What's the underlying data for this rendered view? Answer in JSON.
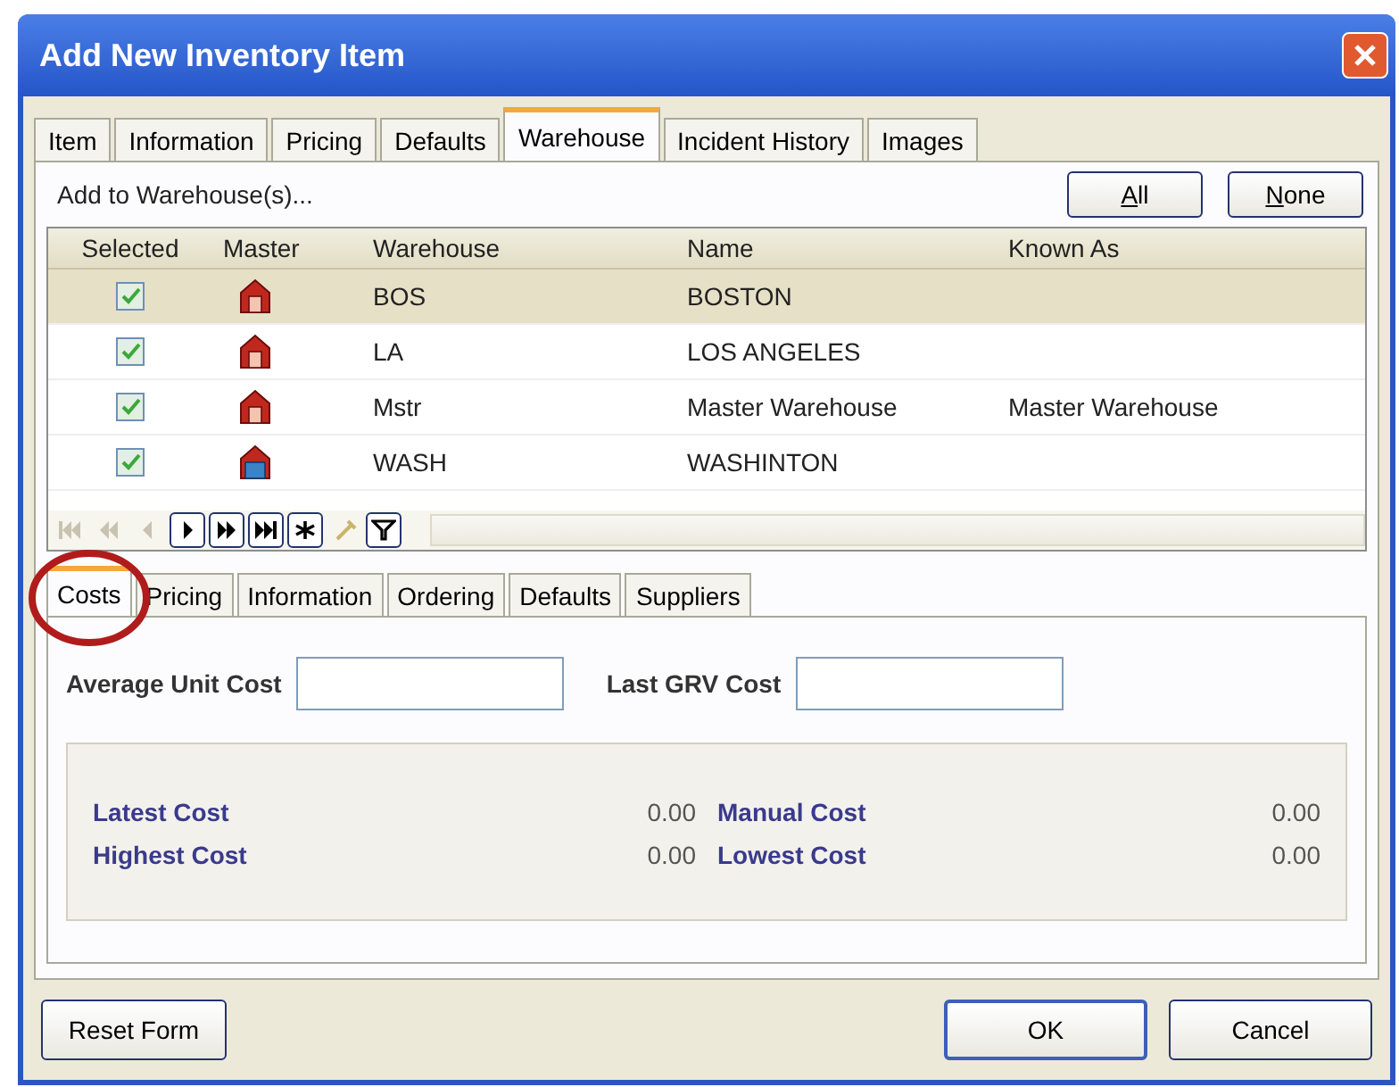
{
  "window": {
    "title": "Add New Inventory Item"
  },
  "tabs": [
    {
      "label": "Item",
      "selected": false
    },
    {
      "label": "Information",
      "selected": false
    },
    {
      "label": "Pricing",
      "selected": false
    },
    {
      "label": "Defaults",
      "selected": false
    },
    {
      "label": "Warehouse",
      "selected": true
    },
    {
      "label": "Incident History",
      "selected": false
    },
    {
      "label": "Images",
      "selected": false
    }
  ],
  "toolbar": {
    "label": "Add to Warehouse(s)...",
    "buttons": [
      "All",
      "None"
    ]
  },
  "grid": {
    "columns": [
      "Selected",
      "Master",
      "Warehouse",
      "Name",
      "Known As"
    ],
    "rows": [
      {
        "checked": true,
        "master": false,
        "warehouse": "BOS",
        "name": "BOSTON",
        "known_as": "",
        "selected": true
      },
      {
        "checked": true,
        "master": false,
        "warehouse": "LA",
        "name": "LOS ANGELES",
        "known_as": "",
        "selected": false
      },
      {
        "checked": true,
        "master": false,
        "warehouse": "Mstr",
        "name": "Master Warehouse",
        "known_as": "Master Warehouse",
        "selected": false
      },
      {
        "checked": true,
        "master": true,
        "warehouse": "WASH",
        "name": "WASHINTON",
        "known_as": "",
        "selected": false
      }
    ]
  },
  "navigator": [
    {
      "kind": "first",
      "disabled": true
    },
    {
      "kind": "prev-page",
      "disabled": true
    },
    {
      "kind": "prev",
      "disabled": true
    },
    {
      "kind": "next",
      "disabled": false
    },
    {
      "kind": "next-page",
      "disabled": false
    },
    {
      "kind": "last",
      "disabled": false
    },
    {
      "kind": "new",
      "disabled": false
    },
    {
      "kind": "edit",
      "disabled": true
    },
    {
      "kind": "filter",
      "disabled": false
    }
  ],
  "sub_tabs": [
    {
      "label": "Costs",
      "selected": true
    },
    {
      "label": "Pricing",
      "selected": false
    },
    {
      "label": "Information",
      "selected": false
    },
    {
      "label": "Ordering",
      "selected": false
    },
    {
      "label": "Defaults",
      "selected": false
    },
    {
      "label": "Suppliers",
      "selected": false
    }
  ],
  "fields": [
    {
      "label": "Average Unit Cost"
    },
    {
      "label": "Last GRV Cost"
    }
  ],
  "summary": [
    {
      "label": "Latest Cost",
      "value": "0.00"
    },
    {
      "label": "Manual Cost",
      "value": "0.00"
    },
    {
      "label": "Highest Cost",
      "value": "0.00"
    },
    {
      "label": "Lowest Cost",
      "value": "0.00"
    }
  ],
  "footer": {
    "reset": "Reset Form",
    "ok": "OK",
    "cancel": "Cancel"
  }
}
